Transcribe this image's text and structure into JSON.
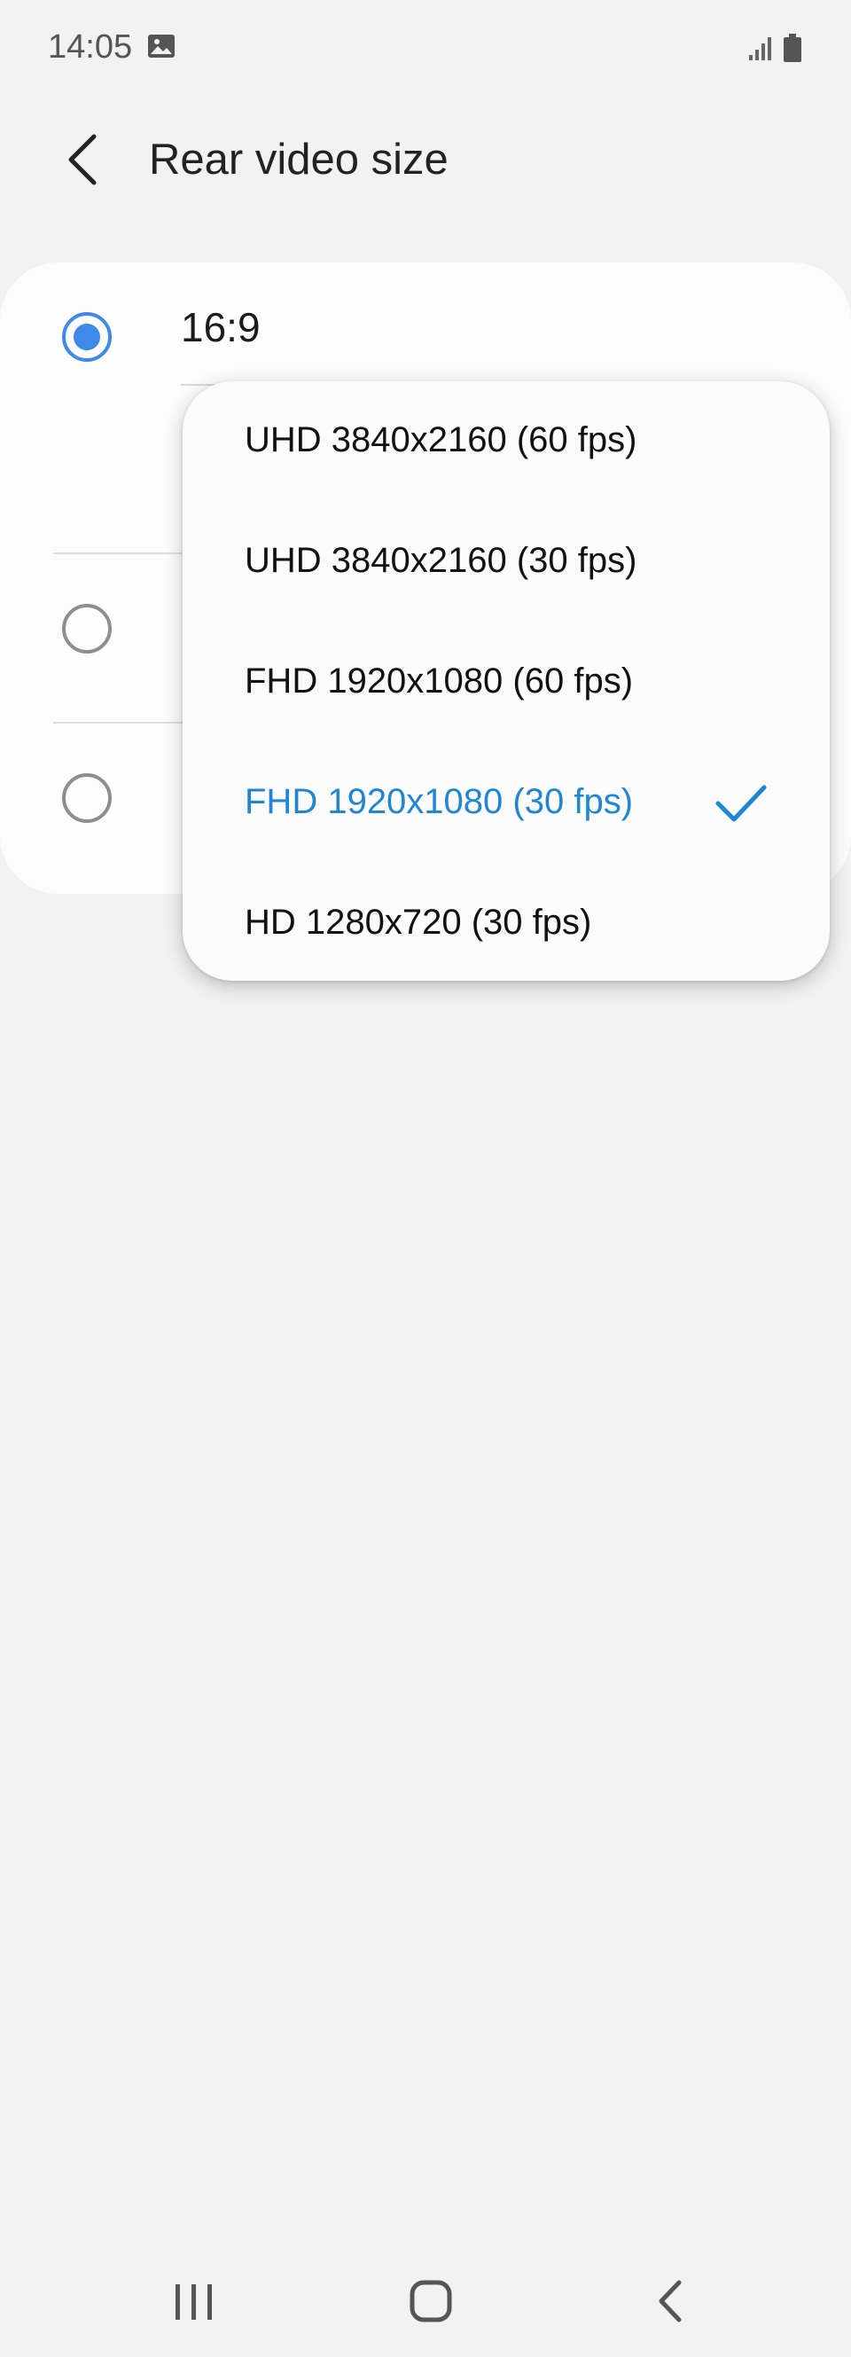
{
  "status_bar": {
    "time": "14:05",
    "icons": [
      "image-icon",
      "signal-icon",
      "battery-icon"
    ]
  },
  "header": {
    "title": "Rear video size",
    "back_icon": "chevron-left-icon"
  },
  "aspect_options": [
    {
      "label": "16:9",
      "selected": true
    },
    {
      "label": "",
      "selected": false
    },
    {
      "label": "",
      "selected": false
    }
  ],
  "dropdown": {
    "items": [
      {
        "label": "UHD 3840x2160 (60 fps)",
        "selected": false
      },
      {
        "label": "UHD 3840x2160 (30 fps)",
        "selected": false
      },
      {
        "label": "FHD 1920x1080 (60 fps)",
        "selected": false
      },
      {
        "label": "FHD 1920x1080 (30 fps)",
        "selected": true
      },
      {
        "label": "HD 1280x720 (30 fps)",
        "selected": false
      }
    ]
  },
  "nav_bar": {
    "buttons": [
      "recent-apps-icon",
      "home-icon",
      "back-icon"
    ]
  },
  "colors": {
    "accent": "#1f86d4",
    "radio_on": "#3f8ae9",
    "background": "#f2f2f2",
    "card": "#fcfcfc"
  }
}
